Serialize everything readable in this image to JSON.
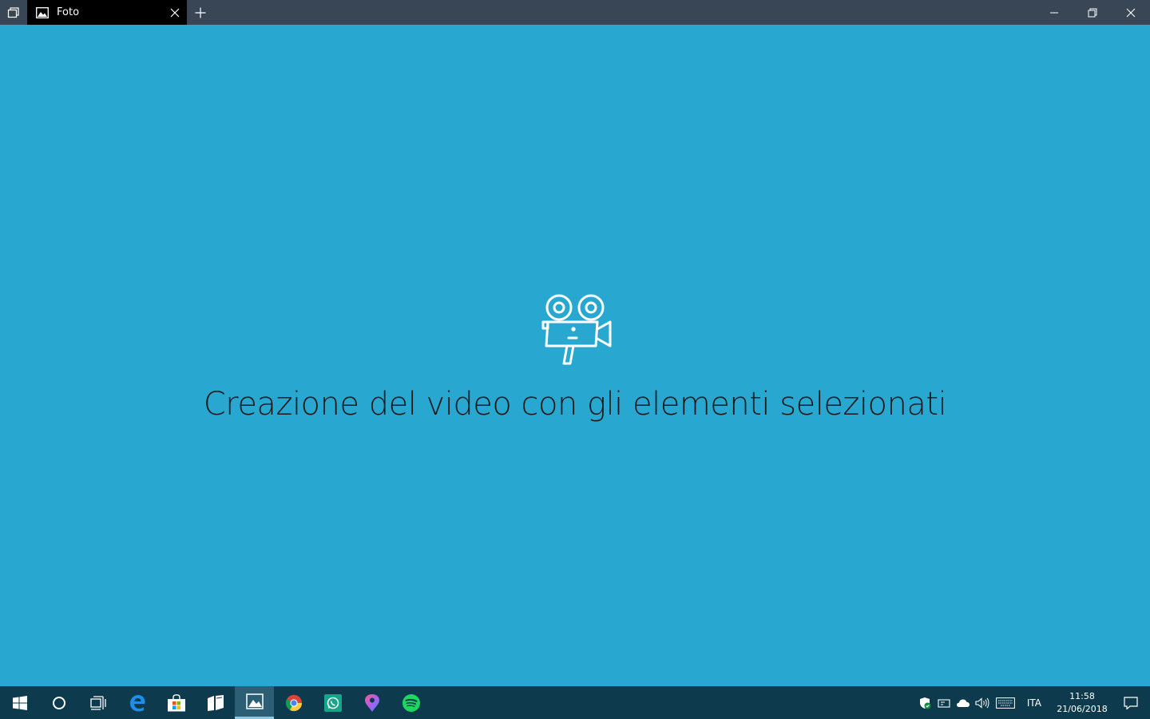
{
  "window": {
    "tab_title": "Foto",
    "icons": {
      "task_view": "tab-overview-icon",
      "tab": "photos-app-icon",
      "tab_close": "close-icon",
      "new_tab": "plus-icon",
      "minimize": "minimize-icon",
      "restore": "restore-icon",
      "close": "close-icon"
    }
  },
  "main": {
    "message": "Creazione del video con gli elementi selezionati",
    "icon": "video-camera-icon",
    "background_color": "#28a7d1"
  },
  "taskbar": {
    "apps": [
      {
        "name": "start",
        "icon": "windows-logo-icon"
      },
      {
        "name": "cortana",
        "icon": "cortana-circle-icon"
      },
      {
        "name": "task-view",
        "icon": "task-view-icon"
      },
      {
        "name": "edge",
        "icon": "edge-icon"
      },
      {
        "name": "store",
        "icon": "store-bag-icon"
      },
      {
        "name": "news",
        "icon": "news-icon"
      },
      {
        "name": "photos",
        "icon": "photos-icon",
        "active": true
      },
      {
        "name": "chrome",
        "icon": "chrome-icon"
      },
      {
        "name": "whatsapp",
        "icon": "whatsapp-icon"
      },
      {
        "name": "maps",
        "icon": "maps-pin-icon"
      },
      {
        "name": "spotify",
        "icon": "spotify-icon"
      }
    ],
    "tray": {
      "language": "ITA",
      "time": "11:58",
      "date": "21/06/2018"
    }
  }
}
